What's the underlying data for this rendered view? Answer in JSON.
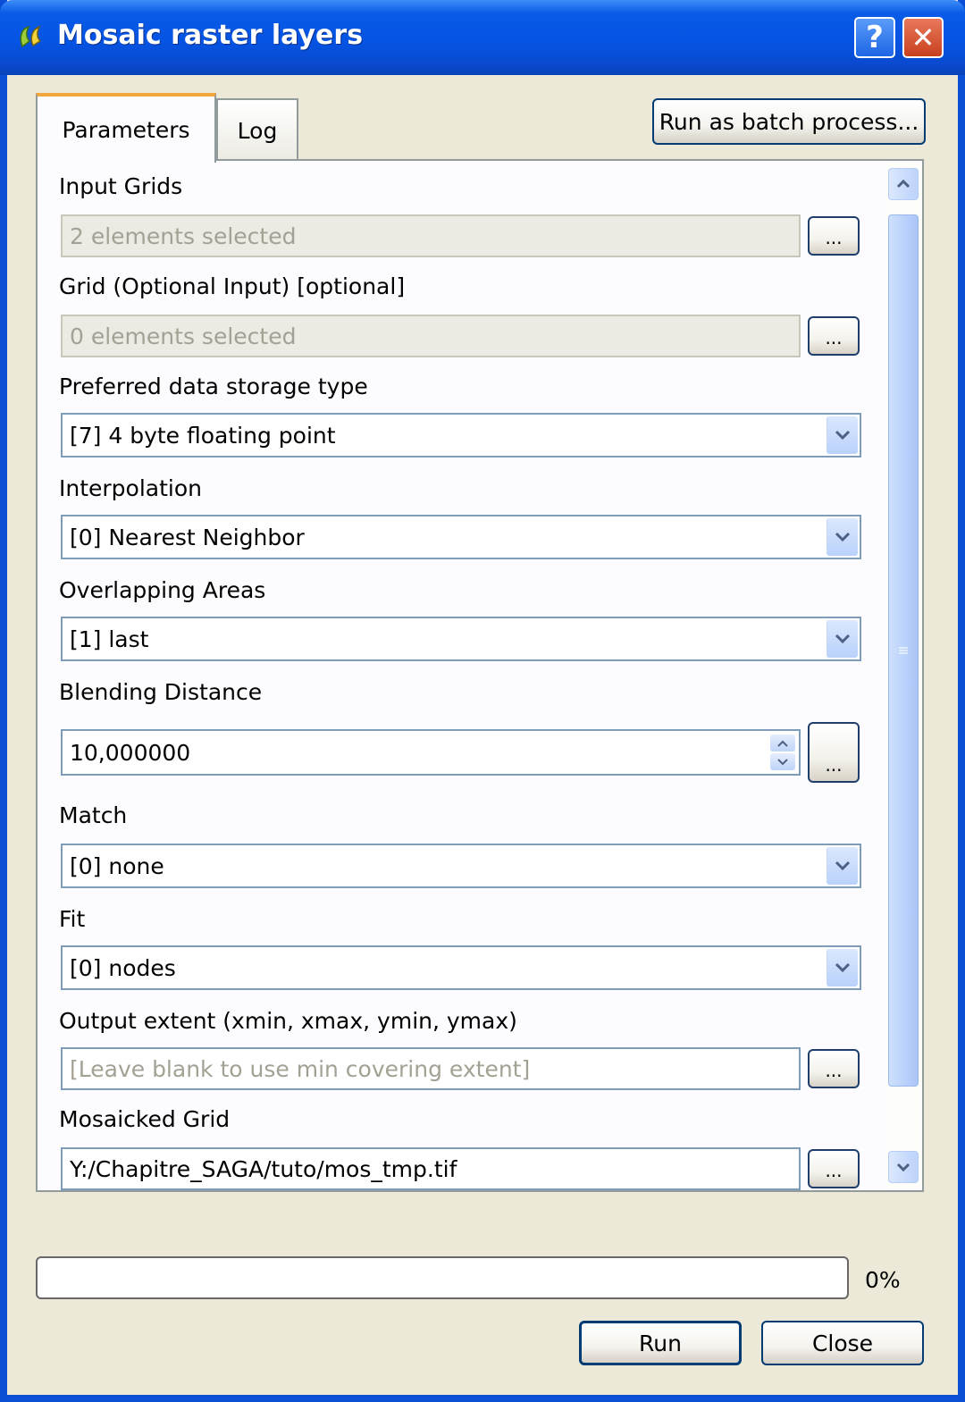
{
  "window": {
    "title": "Mosaic raster layers",
    "help_label": "?",
    "close_label": "✕"
  },
  "tabs": [
    {
      "label": "Parameters",
      "active": true
    },
    {
      "label": "Log",
      "active": false
    }
  ],
  "batch_button": "Run as batch process...",
  "params": {
    "input_grids": {
      "label": "Input Grids",
      "value": "2 elements selected",
      "button": "..."
    },
    "grid_optional": {
      "label": "Grid (Optional Input) [optional]",
      "value": "0 elements selected",
      "button": "..."
    },
    "storage_type": {
      "label": "Preferred data storage type",
      "value": "[7] 4 byte floating point"
    },
    "interpolation": {
      "label": "Interpolation",
      "value": "[0] Nearest Neighbor"
    },
    "overlapping": {
      "label": "Overlapping Areas",
      "value": "[1] last"
    },
    "blending": {
      "label": "Blending Distance",
      "value": "10,000000",
      "button": "..."
    },
    "match": {
      "label": "Match",
      "value": "[0] none"
    },
    "fit": {
      "label": "Fit",
      "value": "[0] nodes"
    },
    "extent": {
      "label": "Output extent (xmin, xmax, ymin, ymax)",
      "placeholder": "[Leave blank to use min covering extent]",
      "button": "..."
    },
    "mosaicked": {
      "label": "Mosaicked Grid",
      "value": "Y:/Chapitre_SAGA/tuto/mos_tmp.tif",
      "button": "..."
    }
  },
  "progress": {
    "value": 0,
    "label": "0%"
  },
  "buttons": {
    "run": "Run",
    "close": "Close"
  },
  "colors": {
    "title_bar": "#0554e3",
    "accent": "#f2a53a",
    "face": "#ece9d8"
  },
  "icons": {
    "app": "qgis-icon",
    "select": "chevron-down-icon",
    "scroll_up": "chevron-up-icon",
    "scroll_down": "chevron-down-icon"
  }
}
